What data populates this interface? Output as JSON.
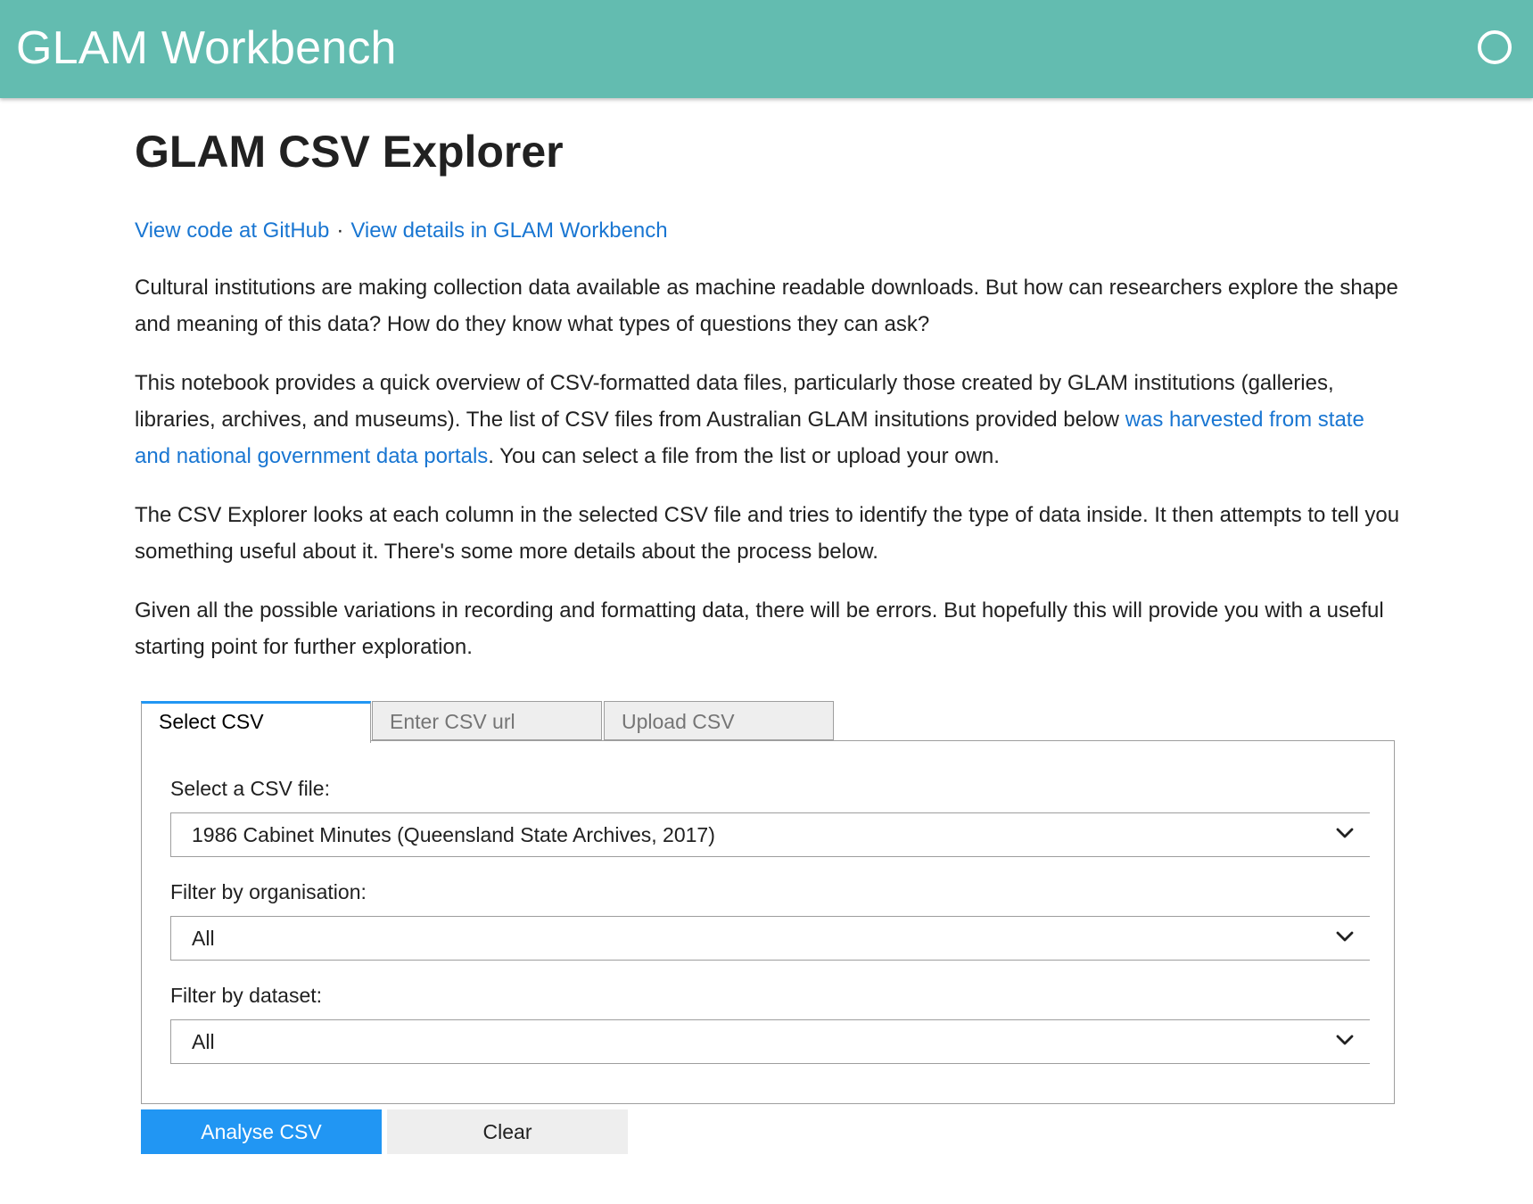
{
  "header": {
    "app_title": "GLAM Workbench",
    "status_icon": "circle-outline-icon",
    "bar_color": "#63bcb0"
  },
  "main": {
    "title": "GLAM CSV Explorer",
    "links": {
      "github": "View code at GitHub",
      "separator": "·",
      "workbench": "View details in GLAM Workbench"
    },
    "paragraphs": {
      "p1": "Cultural institutions are making collection data available as machine readable downloads. But how can researchers explore the shape and meaning of this data? How do they know what types of questions they can ask?",
      "p2_before": "This notebook provides a quick overview of CSV-formatted data files, particularly those created by GLAM institutions (galleries, libraries, archives, and museums). The list of CSV files from Australian GLAM insitutions provided below ",
      "p2_link": "was harvested from state and national government data portals",
      "p2_after": ". You can select a file from the list or upload your own.",
      "p3": "The CSV Explorer looks at each column in the selected CSV file and tries to identify the type of data inside. It then attempts to tell you something useful about it. There's some more details about the process below.",
      "p4": "Given all the possible variations in recording and formatting data, there will be errors. But hopefully this will provide you with a useful starting point for further exploration."
    }
  },
  "widget": {
    "tabs": [
      {
        "label": "Select CSV",
        "active": true
      },
      {
        "label": "Enter CSV url",
        "active": false
      },
      {
        "label": "Upload CSV",
        "active": false
      }
    ],
    "csv_select": {
      "label": "Select a CSV file:",
      "value": "1986 Cabinet Minutes (Queensland State Archives, 2017)"
    },
    "org_filter": {
      "label": "Filter by organisation:",
      "value": "All"
    },
    "dataset_filter": {
      "label": "Filter by dataset:",
      "value": "All"
    },
    "buttons": {
      "analyse": "Analyse CSV",
      "clear": "Clear"
    },
    "accent_color": "#2196f3",
    "link_color": "#1976d2"
  }
}
